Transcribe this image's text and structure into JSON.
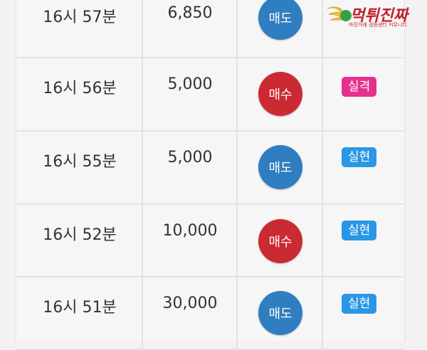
{
  "rows": [
    {
      "time": "16시 57분",
      "qty": "6,850",
      "side": "매도",
      "side_type": "sell",
      "result": "",
      "result_type": ""
    },
    {
      "time": "16시 56분",
      "qty": "5,000",
      "side": "매수",
      "side_type": "buy",
      "result": "실격",
      "result_type": "fail"
    },
    {
      "time": "16시 55분",
      "qty": "5,000",
      "side": "매도",
      "side_type": "sell",
      "result": "실현",
      "result_type": "ok"
    },
    {
      "time": "16시 52분",
      "qty": "10,000",
      "side": "매수",
      "side_type": "buy",
      "result": "실현",
      "result_type": "ok"
    },
    {
      "time": "16시 51분",
      "qty": "30,000",
      "side": "매도",
      "side_type": "sell",
      "result": "실현",
      "result_type": "ok"
    }
  ],
  "watermark": {
    "main": "먹튀진짜",
    "sub": "마진거래 검증센터 커뮤니티"
  },
  "colors": {
    "sell": "#2e7ec0",
    "buy": "#cc2a32",
    "fail": "#e5318d",
    "ok": "#2a96e6"
  }
}
